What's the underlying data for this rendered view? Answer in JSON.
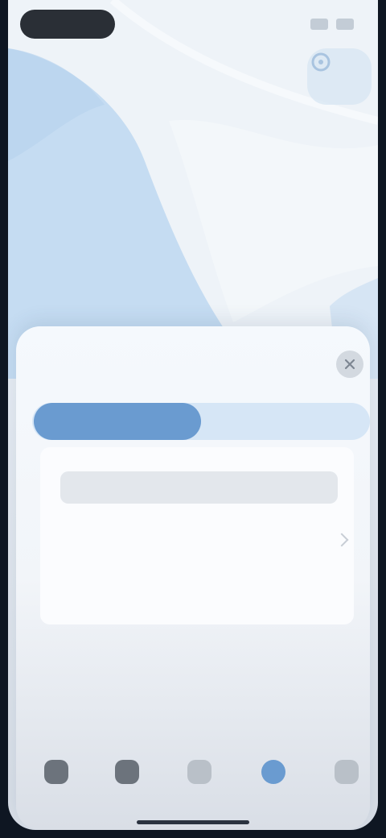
{
  "status_bar": {
    "pill_label": "",
    "icons": [
      "signal-icon",
      "battery-icon"
    ]
  },
  "map": {
    "locate_icon": "locate-icon",
    "colors": {
      "water": "#c9def2",
      "land": "#eef3f8",
      "accent": "#6a9bd0"
    }
  },
  "sheet": {
    "title": "",
    "close_icon": "close-icon",
    "segments": [
      {
        "label": "",
        "active": true
      },
      {
        "label": "",
        "active": false
      }
    ],
    "card": {
      "field_placeholder": "",
      "row_label": "",
      "note": ""
    }
  },
  "tabbar": {
    "tabs": [
      {
        "icon": "tab-icon-1",
        "active": false
      },
      {
        "icon": "tab-icon-2",
        "active": false
      },
      {
        "icon": "tab-icon-3",
        "active": false
      },
      {
        "icon": "tab-icon-4",
        "active": true
      },
      {
        "icon": "tab-icon-5",
        "active": false
      }
    ]
  }
}
